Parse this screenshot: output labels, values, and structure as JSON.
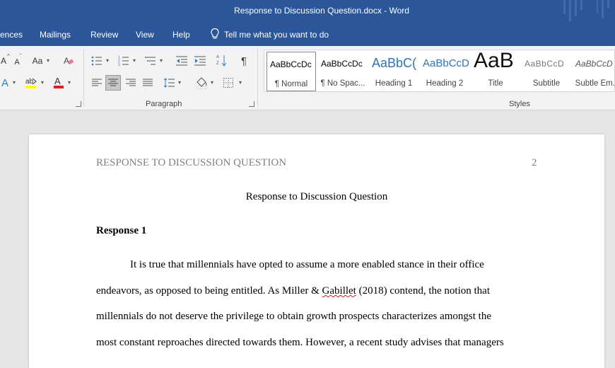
{
  "window": {
    "title": "Response to Discussion Question.docx  -  Word"
  },
  "tabs": [
    {
      "id": "references",
      "label": "ences"
    },
    {
      "id": "mailings",
      "label": "Mailings"
    },
    {
      "id": "review",
      "label": "Review"
    },
    {
      "id": "view",
      "label": "View"
    },
    {
      "id": "help",
      "label": "Help"
    }
  ],
  "tell_me": {
    "icon": "lightbulb-icon",
    "label": "Tell me what you want to do"
  },
  "ribbon": {
    "font_buttons": {
      "change_case": "Aa"
    },
    "paragraph_label": "Paragraph",
    "styles_label": "Styles",
    "styles": [
      {
        "sample": "AaBbCcDc",
        "name": "¶ Normal",
        "selected": true
      },
      {
        "sample": "AaBbCcDc",
        "name": "¶ No Spac..."
      },
      {
        "sample": "AaBbC(",
        "name": "Heading 1"
      },
      {
        "sample": "AaBbCcD",
        "name": "Heading 2"
      },
      {
        "sample": "AaB",
        "name": "Title"
      },
      {
        "sample": "AaBbCcD",
        "name": "Subtitle"
      },
      {
        "sample": "AaBbCcD",
        "name": "Subtle Em..."
      }
    ]
  },
  "colors": {
    "accent": "#2b579a",
    "highlight": "#ffff00",
    "font_color": "#e02020"
  },
  "document": {
    "running_head": "RESPONSE TO DISCUSSION QUESTION",
    "page_number": "2",
    "title": "Response to Discussion Question",
    "heading": "Response 1",
    "lines": [
      "It is true that millennials have opted to assume a more enabled stance in their office",
      "endeavors, as opposed to being entitled. As Miller & ",
      "millennials do not deserve the privilege to obtain growth prospects characterizes amongst the",
      "most constant reproaches directed towards them. However, a recent study advises that managers"
    ],
    "line2_flagged": "Gabillet",
    "line2_rest": " (2018) contend, the notion that"
  }
}
